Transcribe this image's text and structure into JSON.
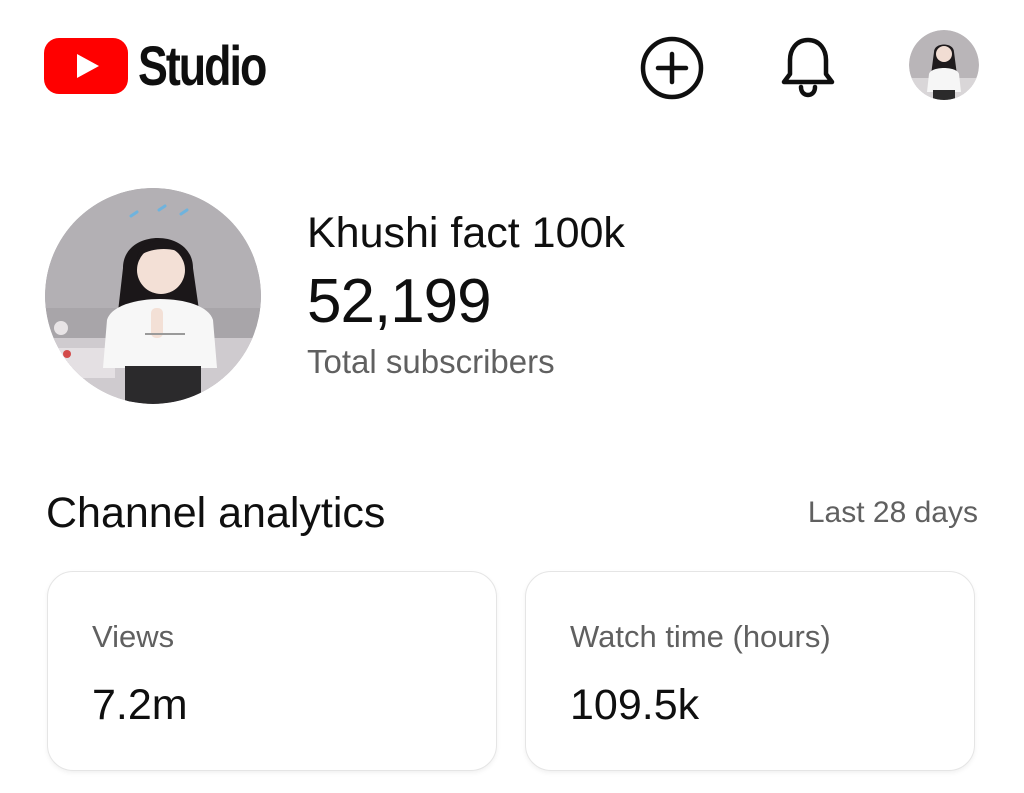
{
  "app": {
    "logo_text": "Studio",
    "brand_color": "#ff0000"
  },
  "header": {
    "create_icon": "plus-circle-icon",
    "notifications_icon": "bell-icon",
    "account_avatar": "avatar-photo"
  },
  "channel": {
    "name": "Khushi fact 100k",
    "subscriber_count": "52,199",
    "subscriber_label": "Total subscribers"
  },
  "analytics": {
    "title": "Channel analytics",
    "period": "Last 28 days",
    "cards": [
      {
        "label": "Views",
        "value": "7.2m"
      },
      {
        "label": "Watch time (hours)",
        "value": "109.5k"
      }
    ]
  }
}
